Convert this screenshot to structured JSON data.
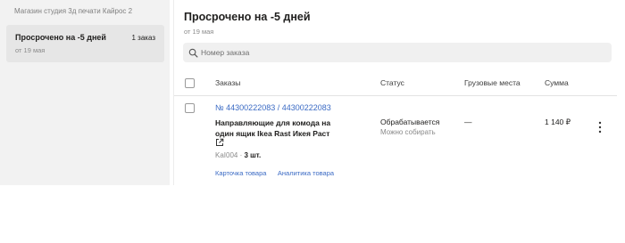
{
  "sidebar": {
    "store_name": "Магазин студия 3д печати Кайрос 2",
    "items": [
      {
        "title": "Просрочено на -5 дней",
        "date": "от 19 мая",
        "count": "1 заказ"
      }
    ]
  },
  "main": {
    "title": "Просрочено на -5 дней",
    "date": "от 19 мая",
    "search": {
      "placeholder": "Номер заказа",
      "value": ""
    },
    "columns": [
      "Заказы",
      "Статус",
      "Грузовые места",
      "Сумма"
    ],
    "orders": [
      {
        "ids": "№ 44300222083 / 44300222083",
        "product": "Направляющие для комода на один ящик Ikea Rast Икея Раст",
        "sku": "KaI004",
        "quantity": "3 шт.",
        "links": [
          "Карточка товара",
          "Аналитика товара"
        ],
        "status": "Обрабатывается",
        "status_sub": "Можно собирать",
        "cargo": "—",
        "sum": "1 140 ₽"
      }
    ]
  },
  "colors": {
    "link": "#3a6ac4",
    "sidebar_bg": "#f2f2f2",
    "selected_bg": "#e6e6e6"
  },
  "icons": [
    "search-icon",
    "external-link-icon",
    "more-vertical-icon"
  ]
}
